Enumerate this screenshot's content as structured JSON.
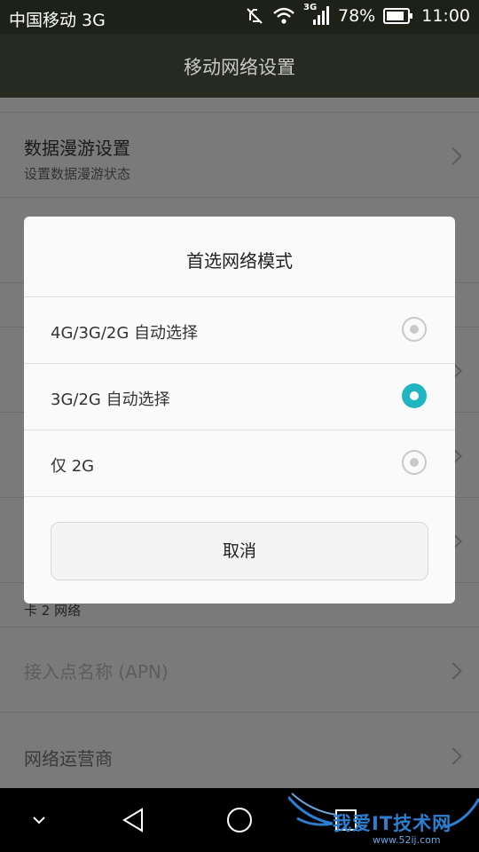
{
  "status_bar": {
    "carrier": "中国移动 3G",
    "network_badge": "3G",
    "battery": "78%",
    "time": "11:00",
    "icons": [
      "mute-icon",
      "wifi-icon",
      "signal-icon",
      "battery-icon"
    ]
  },
  "header": {
    "title": "移动网络设置"
  },
  "background": {
    "rows": [
      {
        "title": "数据漫游设置",
        "subtitle": "设置数据漫游状态"
      },
      {
        "section": "卡 2 网络"
      },
      {
        "title": "接入点名称 (APN)"
      },
      {
        "title": "网络运营商"
      }
    ]
  },
  "dialog": {
    "title": "首选网络模式",
    "options": [
      {
        "label": "4G/3G/2G 自动选择",
        "selected": false
      },
      {
        "label": "3G/2G 自动选择",
        "selected": true
      },
      {
        "label": "仅 2G",
        "selected": false
      }
    ],
    "cancel_label": "取消"
  },
  "nav": {
    "icons": [
      "collapse-icon",
      "back-icon",
      "home-icon",
      "recents-icon"
    ]
  },
  "watermark": {
    "text": "我爱IT技术网",
    "url": "www.52ij.com"
  },
  "colors": {
    "accent": "#21b5c1",
    "title_bar": "#262a20",
    "status_bar": "#1d2118"
  }
}
